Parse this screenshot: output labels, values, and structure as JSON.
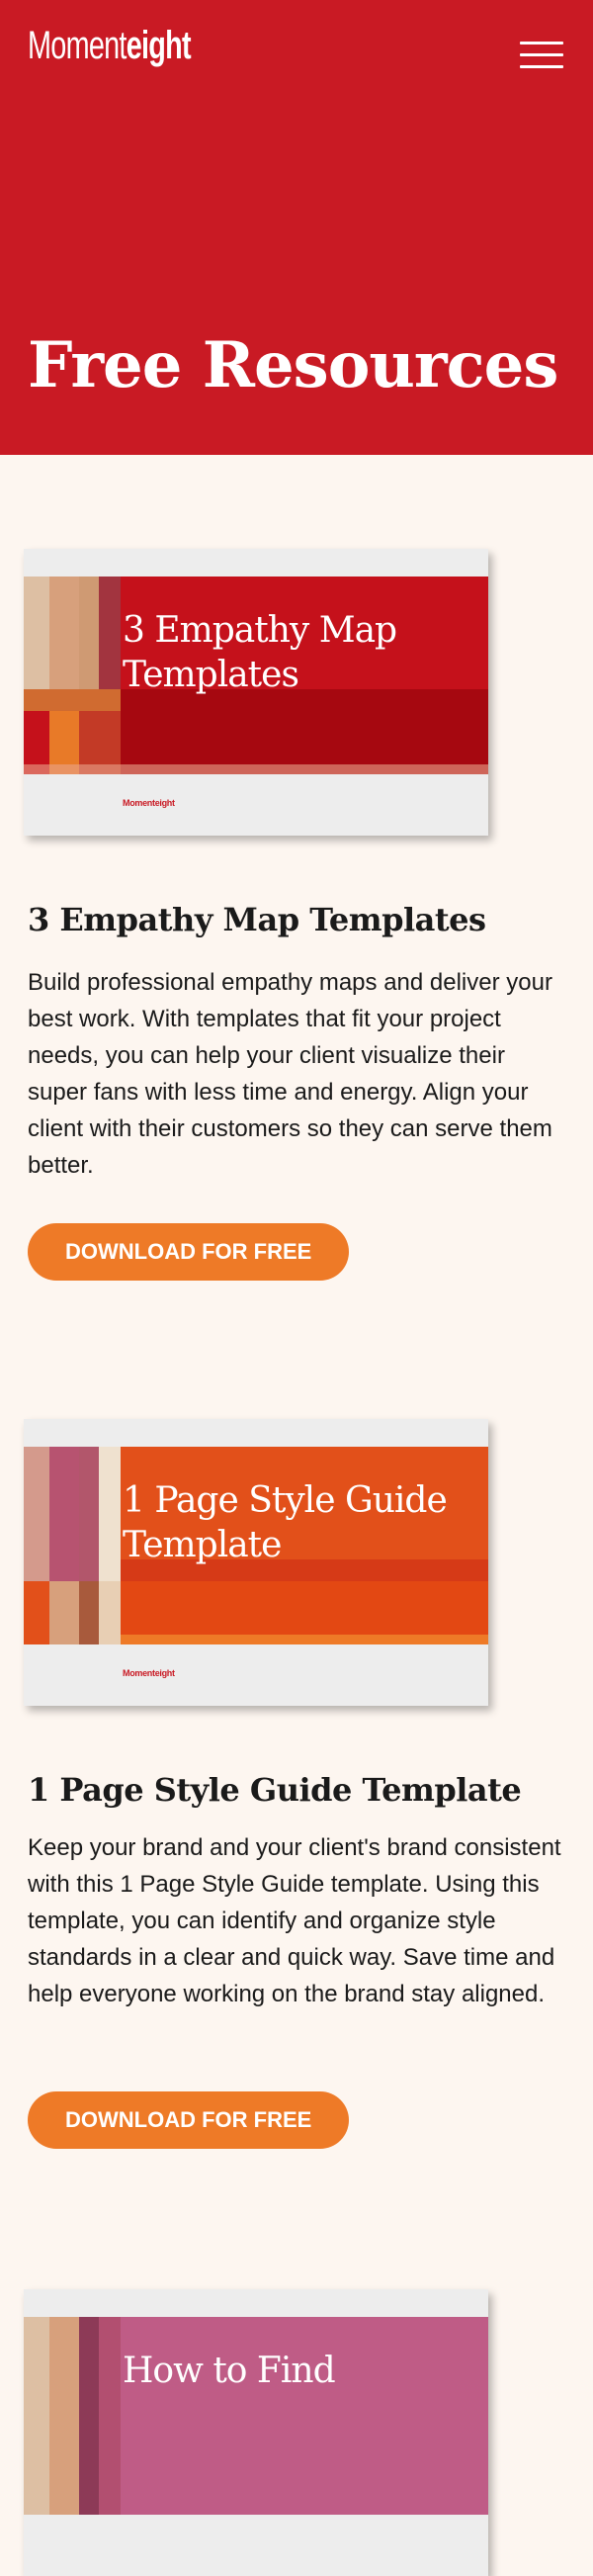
{
  "brand": {
    "logo_light": "Moment",
    "logo_bold": "eight"
  },
  "header": {
    "menu_icon": "hamburger-menu-icon"
  },
  "hero": {
    "title": "Free Resources"
  },
  "colors": {
    "hero_bg": "#c91a24",
    "page_bg": "#fdf6f0",
    "button_bg": "#ee7a27"
  },
  "resources": [
    {
      "cover_title": "3 Empathy Map Templates",
      "cover_logo": "Momenteight",
      "title": "3 Empathy Map Templates",
      "description": "Build professional empathy maps and deliver your best work. With templates that fit your project needs, you can help your client visualize their super fans with less time and energy. Align your client with their customers so they can serve them better.",
      "button_label": "DOWNLOAD FOR FREE"
    },
    {
      "cover_title": "1 Page Style Guide Template",
      "cover_logo": "Momenteight",
      "title": "1 Page Style Guide Template",
      "description": "Keep your brand and your client's brand consistent with this 1 Page Style Guide template. Using this template, you can identify and organize style standards in a clear and quick way. Save time and help everyone working on the brand stay aligned.",
      "button_label": "DOWNLOAD FOR FREE"
    },
    {
      "cover_title": "How to Find"
    }
  ]
}
